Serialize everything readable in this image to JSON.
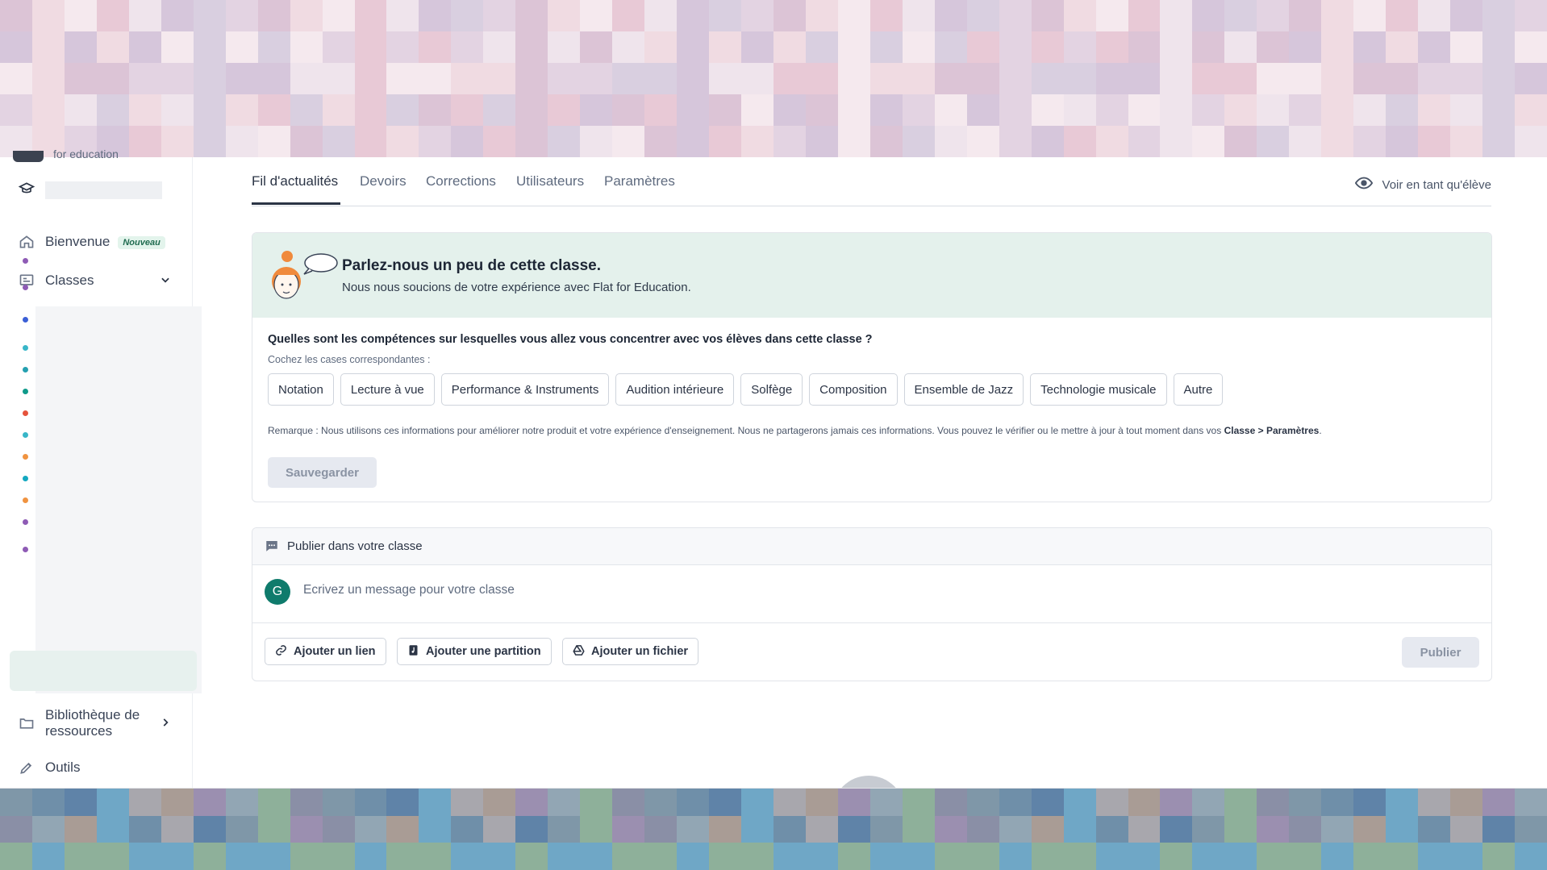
{
  "sidebar": {
    "logo_text": "for education",
    "items": [
      {
        "label": "Bienvenue",
        "icon": "home-icon",
        "badge": "Nouveau"
      },
      {
        "label": "Classes",
        "icon": "classes-icon"
      },
      {
        "label": "Bibliothèque de ressources",
        "icon": "library-icon"
      },
      {
        "label": "Outils",
        "icon": "tools-icon"
      }
    ],
    "class_dot_colors": [
      "#8e5bb5",
      "#8e5bb5",
      "#3b5fd6",
      "#38b6c8",
      "#25a0b0",
      "#0f9a8a",
      "#e5533c",
      "#38b6c8",
      "#f09340",
      "#14a8c0",
      "#f09340",
      "#8e5bb5",
      "#8e5bb5"
    ]
  },
  "tabs": {
    "items": [
      "Fil d'actualités",
      "Devoirs",
      "Corrections",
      "Utilisateurs",
      "Paramètres"
    ],
    "view_as": "Voir en tant qu'élève"
  },
  "survey": {
    "title": "Parlez-nous un peu de cette classe.",
    "subtitle": "Nous nous soucions de votre expérience avec Flat for Education.",
    "question": "Quelles sont les compétences sur lesquelles vous allez vous concentrer avec vos élèves dans cette classe ?",
    "hint": "Cochez les cases correspondantes :",
    "options": [
      "Notation",
      "Lecture à vue",
      "Performance & Instruments",
      "Audition intérieure",
      "Solfège",
      "Composition",
      "Ensemble de Jazz",
      "Technologie musicale",
      "Autre"
    ],
    "remark": "Remarque : Nous utilisons ces informations pour améliorer notre produit et votre expérience d'enseignement. Nous ne partagerons jamais ces informations. Vous pouvez le vérifier ou le mettre à jour à tout moment dans vos",
    "remark_link": "Classe > Paramètres",
    "remark_end": ".",
    "save_label": "Sauvegarder"
  },
  "publish": {
    "header": "Publier dans votre classe",
    "avatar_initial": "G",
    "placeholder": "Ecrivez un message pour votre classe",
    "add_link": "Ajouter un lien",
    "add_score": "Ajouter une partition",
    "add_file": "Ajouter un fichier",
    "publish_label": "Publier"
  },
  "colors": {
    "accent": "#2b3445",
    "survey_header_bg": "#e4f1ec",
    "avatar_bg": "#0f7b6c"
  }
}
